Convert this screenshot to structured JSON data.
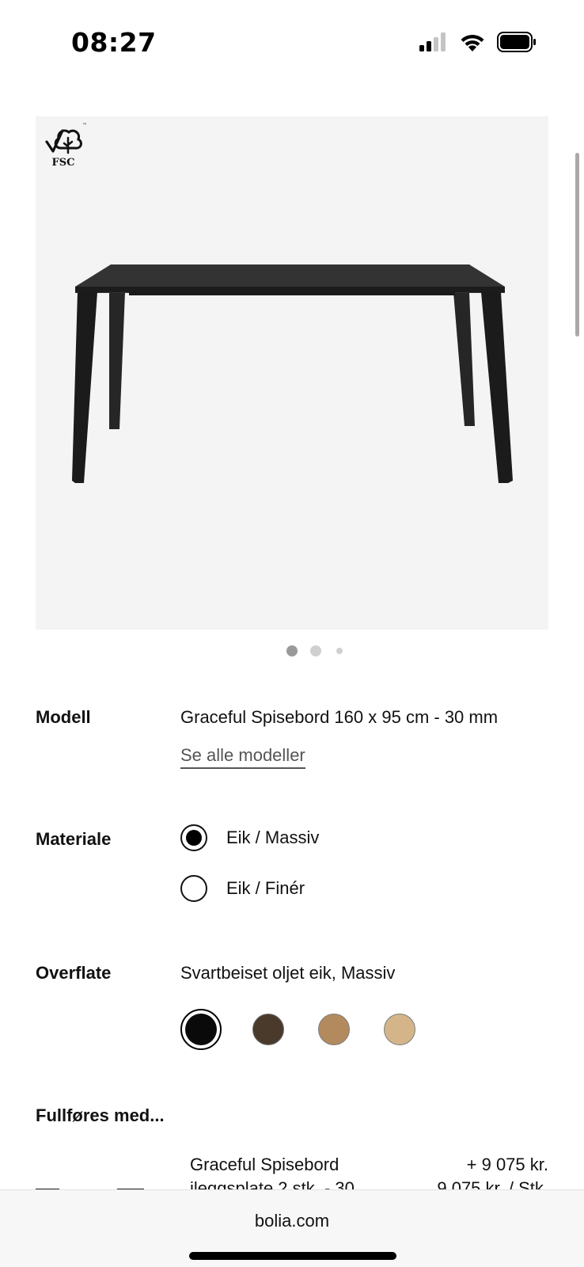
{
  "status_bar": {
    "time": "08:27",
    "icons": [
      "cellular-signal-icon",
      "wifi-icon",
      "battery-icon"
    ]
  },
  "product": {
    "image_alt": "table-image",
    "fsc_label": "FSC",
    "carousel": {
      "total": 3,
      "active": 1
    }
  },
  "model": {
    "label": "Modell",
    "value": "Graceful Spisebord 160 x 95 cm - 30 mm",
    "see_all": "Se alle modeller"
  },
  "material": {
    "label": "Materiale",
    "options": [
      {
        "label": "Eik / Massiv",
        "selected": true
      },
      {
        "label": "Eik / Finér",
        "selected": false
      }
    ]
  },
  "finish": {
    "label": "Overflate",
    "value": "Svartbeiset oljet eik, Massiv",
    "swatches": [
      {
        "color": "#0a0a0a",
        "selected": true
      },
      {
        "color": "#4a3a2c",
        "selected": false
      },
      {
        "color": "#b38a5e",
        "selected": false
      },
      {
        "color": "#d4b58a",
        "selected": false
      }
    ]
  },
  "addons": {
    "title": "Fullføres med...",
    "item": {
      "name_line1": "Graceful Spisebord",
      "name_line2": "ileggsplate 2 stk. - 30",
      "price": "+ 9 075 kr.",
      "unit_price": "9 075 kr. / Stk."
    }
  },
  "browser": {
    "url": "bolia.com"
  }
}
